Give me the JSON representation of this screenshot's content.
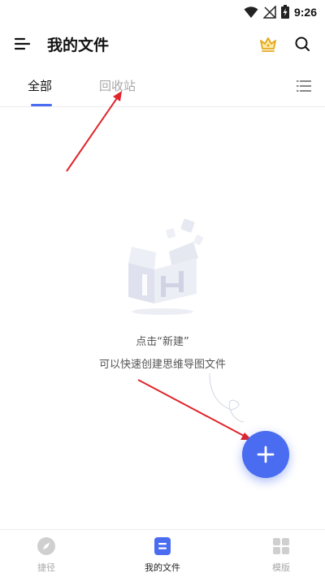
{
  "status_bar": {
    "time": "9:26",
    "icons": [
      "wifi-icon",
      "no-signal-icon",
      "battery-charging-icon"
    ]
  },
  "header": {
    "title": "我的文件",
    "icons": [
      "menu-icon",
      "crown-icon",
      "search-icon"
    ]
  },
  "tabs": [
    {
      "label": "全部",
      "active": true
    },
    {
      "label": "回收站",
      "active": false
    }
  ],
  "empty_state": {
    "line1": "点击“新建”",
    "line2": "可以快速创建思维导图文件"
  },
  "fab": {
    "icon": "plus-icon"
  },
  "bottom_nav": [
    {
      "label": "捷径",
      "icon": "compass-icon",
      "active": false
    },
    {
      "label": "我的文件",
      "icon": "file-icon",
      "active": true
    },
    {
      "label": "模版",
      "icon": "grid-icon",
      "active": false
    }
  ],
  "colors": {
    "accent": "#4a6cf0",
    "annotation_arrow": "#e0242b",
    "inactive": "#a8a8a8"
  }
}
